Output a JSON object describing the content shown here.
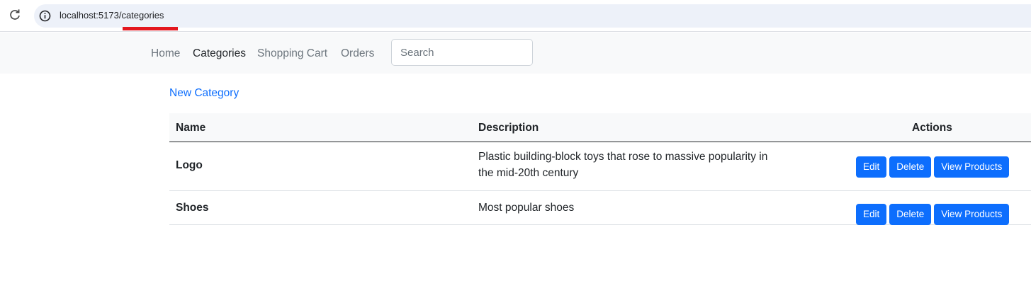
{
  "browser": {
    "url": "localhost:5173/categories",
    "icons": {
      "reload": "reload-icon",
      "site_info": "info-icon"
    },
    "highlight_color": "#e3161e"
  },
  "navbar": {
    "links": [
      {
        "label": "Home",
        "active": false
      },
      {
        "label": "Categories",
        "active": true
      },
      {
        "label": "Shopping Cart",
        "active": false
      },
      {
        "label": "Orders",
        "active": false
      }
    ],
    "search_placeholder": "Search"
  },
  "page": {
    "new_category_label": "New Category",
    "accent_color": "#0d6efd"
  },
  "table": {
    "headers": {
      "name": "Name",
      "description": "Description",
      "actions": "Actions"
    },
    "rows": [
      {
        "name": "Logo",
        "description": "Plastic building-block toys that rose to massive popularity in the mid-20th century"
      },
      {
        "name": "Shoes",
        "description": "Most popular shoes"
      }
    ],
    "row_actions": {
      "edit": "Edit",
      "delete": "Delete",
      "view_products": "View Products"
    }
  }
}
